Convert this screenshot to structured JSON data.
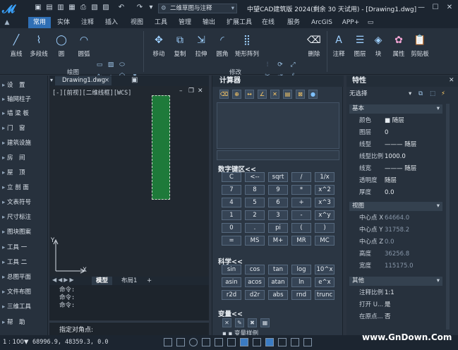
{
  "app": {
    "title": "中望CAD建筑版 2024(剩余 30 天试用) - [Drawing1.dwg]",
    "workspace": "二维草图与注释"
  },
  "ribbon": {
    "tabs": [
      "常用",
      "实体",
      "注释",
      "插入",
      "视图",
      "工具",
      "管理",
      "输出",
      "扩展工具",
      "在线",
      "服务",
      "ArcGIS",
      "APP+"
    ],
    "draw_group_label": "绘图",
    "modify_group_label": "修改",
    "draw_buttons": [
      "直线",
      "多段线",
      "圆",
      "圆弧"
    ],
    "modify_buttons": [
      "移动",
      "复制",
      "拉伸",
      "圆角",
      "矩形阵列",
      "删除"
    ],
    "right_buttons": [
      "注释",
      "图层",
      "块",
      "属性",
      "剪贴板"
    ]
  },
  "leftpanel": {
    "items": [
      "设　置",
      "轴网柱子",
      "墙 梁 板",
      "门　窗",
      "建筑设施",
      "房　间",
      "屋　顶",
      "立 剖 面",
      "文表符号",
      "尺寸标注",
      "图块图案",
      "工具 一",
      "工具 二",
      "总图平面",
      "文件布图",
      "三维工具",
      "帮　助"
    ]
  },
  "drawing": {
    "doc_tab": "Drawing1.dwg",
    "view_label": "[-][前视][二维线框][WCS]",
    "layout_tabs": [
      "模型",
      "布局1",
      "+"
    ],
    "history": [
      "命令:",
      "命令:",
      "命令:"
    ],
    "prompt": "指定对角点:",
    "axis_x": "X",
    "axis_y": "Y"
  },
  "calculator": {
    "title": "计算器",
    "numpad_label": "数字键区<<",
    "numpad_keys": [
      [
        "C",
        "<--",
        "sqrt",
        "/",
        "1/x"
      ],
      [
        "7",
        "8",
        "9",
        "*",
        "x^2"
      ],
      [
        "4",
        "5",
        "6",
        "+",
        "x^3"
      ],
      [
        "1",
        "2",
        "3",
        "-",
        "x^y"
      ],
      [
        "0",
        ".",
        "pi",
        "(",
        ")"
      ],
      [
        "=",
        "MS",
        "M+",
        "MR",
        "MC"
      ]
    ],
    "science_label": "科学<<",
    "science_keys": [
      [
        "sin",
        "cos",
        "tan",
        "log",
        "10^x"
      ],
      [
        "asin",
        "acos",
        "atan",
        "ln",
        "e^x"
      ],
      [
        "r2d",
        "d2r",
        "abs",
        "rnd",
        "trunc"
      ]
    ],
    "variables_label": "变量<<",
    "variable_item": "变量样例"
  },
  "properties": {
    "title": "特性",
    "selection": "无选择",
    "categories": {
      "basic": "基本",
      "view": "视图",
      "other": "其他"
    },
    "basic": [
      {
        "k": "颜色",
        "v": "■ 随层"
      },
      {
        "k": "图层",
        "v": "0"
      },
      {
        "k": "线型",
        "v": "——— 随层"
      },
      {
        "k": "线型比例",
        "v": "1000.0"
      },
      {
        "k": "线宽",
        "v": "——— 随层"
      },
      {
        "k": "透明度",
        "v": "随层"
      },
      {
        "k": "厚度",
        "v": "0.0"
      }
    ],
    "view": [
      {
        "k": "中心点 X",
        "v": "64664.0"
      },
      {
        "k": "中心点 Y",
        "v": "31758.2"
      },
      {
        "k": "中心点 Z",
        "v": "0.0"
      },
      {
        "k": "高度",
        "v": "36256.8"
      },
      {
        "k": "宽度",
        "v": "115175.0"
      }
    ],
    "other": [
      {
        "k": "注释比例",
        "v": "1:1"
      },
      {
        "k": "打开 U...",
        "v": "是"
      },
      {
        "k": "在原点...",
        "v": "否"
      }
    ]
  },
  "statusbar": {
    "scale": "1 : 100▼",
    "coords": "68996.9, 48359.3, 0.0"
  },
  "watermark": "www.GnDown.Com"
}
